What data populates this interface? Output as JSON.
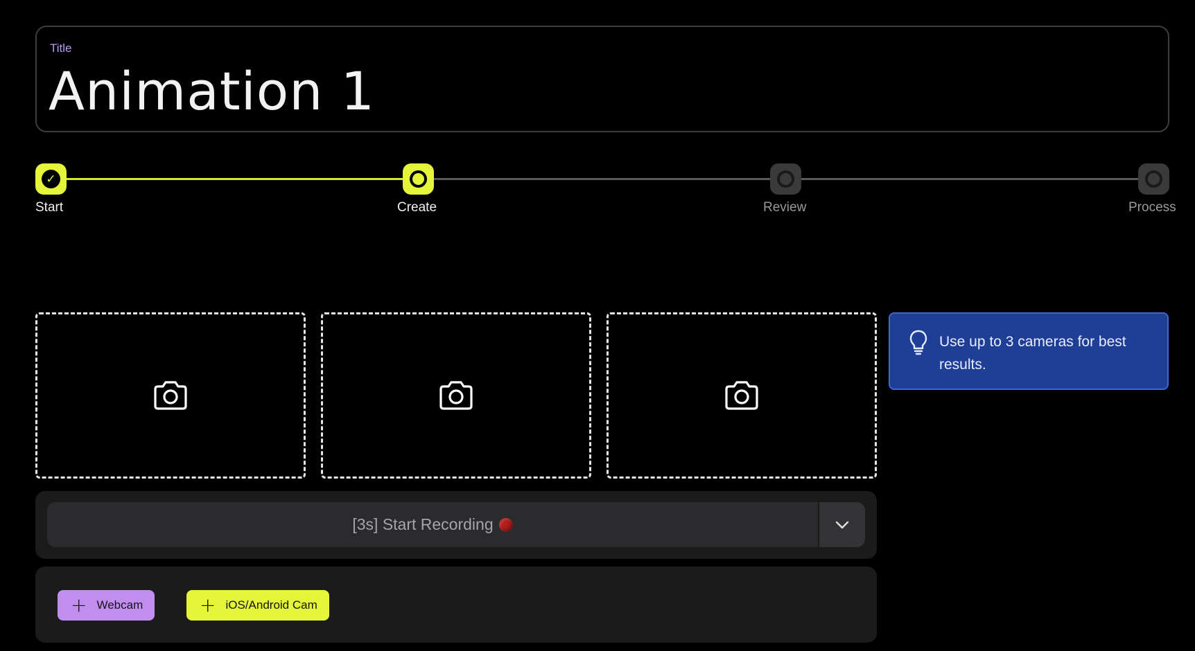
{
  "title_field": {
    "label": "Title",
    "value": "Animation 1"
  },
  "stepper": {
    "steps": [
      {
        "label": "Start",
        "state": "completed"
      },
      {
        "label": "Create",
        "state": "current"
      },
      {
        "label": "Review",
        "state": "pending"
      },
      {
        "label": "Process",
        "state": "pending"
      }
    ],
    "check_glyph": "✓"
  },
  "camera_slots": [
    {
      "icon": "camera-icon"
    },
    {
      "icon": "camera-icon"
    },
    {
      "icon": "camera-icon"
    }
  ],
  "tip": {
    "icon": "lightbulb-icon",
    "text": "Use up to 3 cameras for best results."
  },
  "record": {
    "label": "[3s] Start Recording",
    "dropdown_icon": "chevron-down-icon"
  },
  "sources": {
    "webcam_label": "Webcam",
    "mobile_label": "iOS/Android Cam",
    "plus_glyph": "+"
  },
  "colors": {
    "accent_lime": "#e4f53a",
    "accent_purple": "#c18ef0",
    "tip_blue": "#1f3f97",
    "record_red": "#b01e1e"
  }
}
